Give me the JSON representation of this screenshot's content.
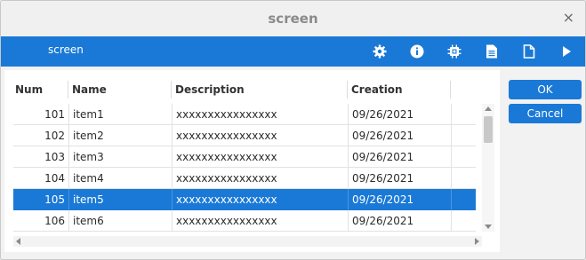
{
  "window": {
    "title": "screen",
    "close_glyph": "×"
  },
  "toolbar": {
    "label": "screen",
    "icons": [
      "gear-icon",
      "info-icon",
      "chip-icon",
      "document-icon",
      "blank-document-icon",
      "play-icon"
    ]
  },
  "table": {
    "columns": [
      "Num",
      "Name",
      "Description",
      "Creation"
    ],
    "rows": [
      {
        "num": "101",
        "name": "item1",
        "description": "xxxxxxxxxxxxxxxx",
        "creation": "09/26/2021"
      },
      {
        "num": "102",
        "name": "item2",
        "description": "xxxxxxxxxxxxxxxx",
        "creation": "09/26/2021"
      },
      {
        "num": "103",
        "name": "item3",
        "description": "xxxxxxxxxxxxxxxx",
        "creation": "09/26/2021"
      },
      {
        "num": "104",
        "name": "item4",
        "description": "xxxxxxxxxxxxxxxx",
        "creation": "09/26/2021"
      },
      {
        "num": "105",
        "name": "item5",
        "description": "xxxxxxxxxxxxxxxx",
        "creation": "09/26/2021",
        "selected": true
      },
      {
        "num": "106",
        "name": "item6",
        "description": "xxxxxxxxxxxxxxxx",
        "creation": "09/26/2021"
      }
    ]
  },
  "buttons": {
    "ok": "OK",
    "cancel": "Cancel"
  },
  "colors": {
    "accent": "#1a79d6"
  }
}
